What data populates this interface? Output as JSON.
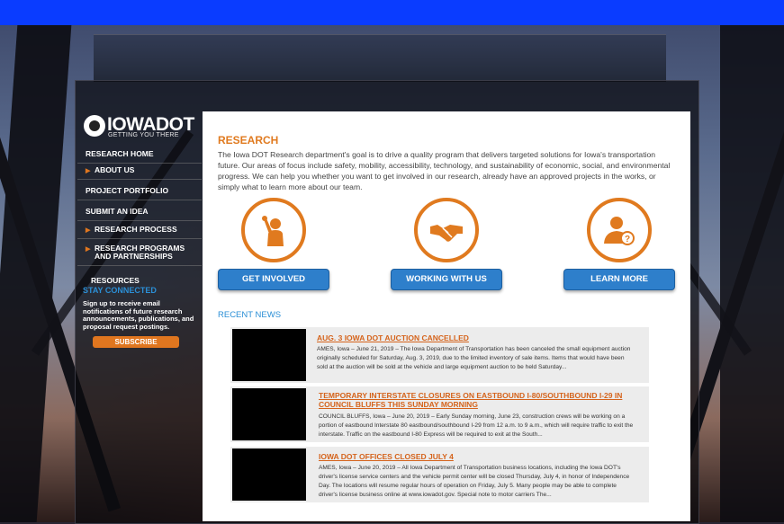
{
  "logo": {
    "wordmark": "IOWADOT",
    "tagline": "GETTING YOU THERE"
  },
  "nav": [
    {
      "label": "RESEARCH HOME",
      "sub": false
    },
    {
      "label": "ABOUT US",
      "sub": true
    },
    {
      "label": "PROJECT PORTFOLIO",
      "sub": false
    },
    {
      "label": "SUBMIT AN IDEA",
      "sub": false
    },
    {
      "label": "RESEARCH PROCESS",
      "sub": true
    },
    {
      "label": "RESEARCH PROGRAMS AND PARTNERSHIPS",
      "sub": true
    },
    {
      "label": "RESOURCES",
      "sub": false
    }
  ],
  "sidebar": {
    "stay_connected": "STAY CONNECTED",
    "signup_text": "Sign up to receive email notifications of future research announcements, publications, and proposal request postings.",
    "subscribe_label": "SUBSCRIBE"
  },
  "main": {
    "heading": "RESEARCH",
    "intro": "The Iowa DOT Research department's goal is to drive a quality program that delivers targeted solutions for Iowa's transportation future. Our areas of focus include safety, mobility, accessibility, technology, and sustainability of economic, social, and environmental progress. We can help you whether you want to get involved in our research, already have an approved projects in the works, or simply what to learn more about our team.",
    "actions": [
      {
        "label": "GET INVOLVED",
        "icon": "raised-hand-person-icon"
      },
      {
        "label": "WORKING WITH US",
        "icon": "handshake-icon"
      },
      {
        "label": "LEARN MORE",
        "icon": "person-question-icon"
      }
    ],
    "recent_news_heading": "RECENT NEWS",
    "news": [
      {
        "title": "AUG. 3 IOWA DOT AUCTION CANCELLED",
        "body": "AMES, Iowa – June 21, 2019 – The Iowa Department of Transportation has been canceled the small equipment auction originally scheduled for Saturday, Aug. 3, 2019, due to the limited inventory of sale items. Items that would have been sold at the auction will be sold at the vehicle and large equipment auction to be held Saturday..."
      },
      {
        "title": "TEMPORARY INTERSTATE CLOSURES ON EASTBOUND I-80/SOUTHBOUND I-29 IN COUNCIL BLUFFS THIS SUNDAY MORNING",
        "body": "COUNCIL BLUFFS, Iowa – June 20, 2019 – Early Sunday morning, June 23, construction crews will be working on a portion of eastbound Interstate 80 eastbound/southbound I-29 from 12 a.m. to 9 a.m., which will require traffic to exit the interstate. Traffic on the eastbound I-80 Express will be required to exit at the South..."
      },
      {
        "title": "IOWA DOT OFFICES CLOSED JULY 4",
        "body": "AMES, Iowa – June 20, 2019 – All Iowa Department of Transportation business locations, including the Iowa DOT's driver's license service centers and the vehicle permit center will be closed Thursday, July 4, in honor of Independence Day. The locations will resume regular hours of operation on Friday, July 5. Many people may be able to complete driver's license business online at www.iowadot.gov. Special note to motor carriers The..."
      }
    ]
  },
  "colors": {
    "accent_orange": "#e07a1f",
    "link_blue": "#2b8fd6",
    "top_bar": "#0a3cff"
  }
}
